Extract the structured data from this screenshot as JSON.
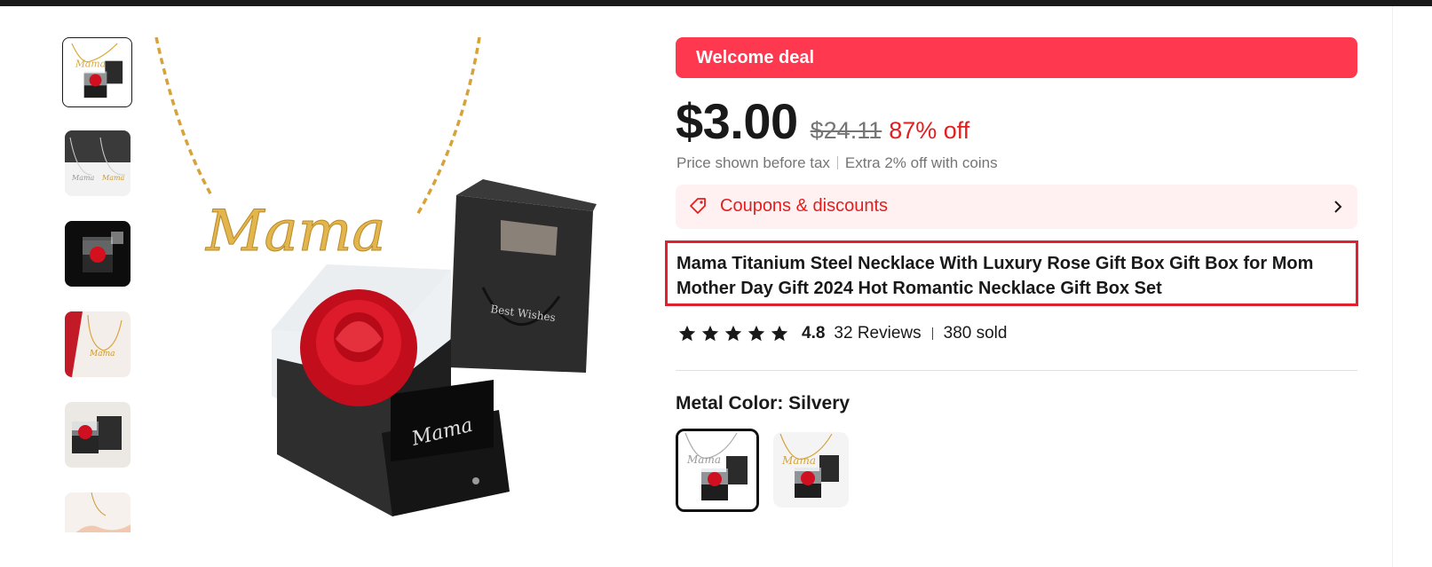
{
  "deal_banner": "Welcome deal",
  "price": {
    "current": "$3.00",
    "original": "$24.11",
    "discount": "87% off",
    "tax_note": "Price shown before tax",
    "coins_note": "Extra 2% off with coins"
  },
  "coupons": {
    "label": "Coupons & discounts"
  },
  "product": {
    "title": "Mama Titanium Steel Necklace With Luxury Rose Gift Box Gift Box for Mom Mother Day Gift 2024 Hot Romantic Necklace Gift Box Set"
  },
  "rating": {
    "value": "4.8",
    "stars": 5,
    "reviews": "32 Reviews",
    "sold": "380 sold"
  },
  "variant": {
    "label": "Metal Color: Silvery",
    "options": [
      "silvery",
      "gold"
    ],
    "selected": "silvery"
  },
  "gallery": {
    "thumbnails": [
      "gift-box-with-necklace",
      "silver-and-gold-necklaces",
      "rose-box-black",
      "gold-necklace-on-box",
      "rose-box-and-bag",
      "necklace-in-hand"
    ],
    "selected_index": 0,
    "main_image_text": "Mama"
  },
  "colors": {
    "accent": "#fd384f",
    "discount": "#e02020",
    "coupon_bg": "#fff0f1",
    "highlight_border": "#e02030"
  },
  "icons": {
    "coupon": "tag-icon",
    "chevron": "chevron-right-icon",
    "star": "star-icon"
  }
}
